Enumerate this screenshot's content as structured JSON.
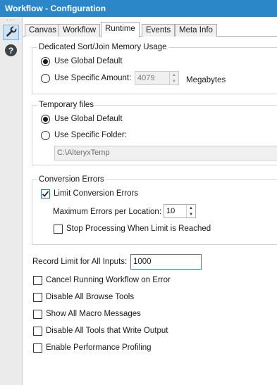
{
  "window": {
    "title": "Workflow - Configuration"
  },
  "sidebar": {
    "tool_icon": "wrench-icon",
    "help_icon": "question-icon",
    "help_glyph": "?",
    "dots": "···"
  },
  "tabs": [
    {
      "label": "Canvas",
      "active": false
    },
    {
      "label": "Workflow",
      "active": false
    },
    {
      "label": "Runtime",
      "active": true
    },
    {
      "label": "Events",
      "active": false
    },
    {
      "label": "Meta Info",
      "active": false
    }
  ],
  "memory": {
    "title": "Dedicated Sort/Join Memory Usage",
    "use_global_label": "Use Global Default",
    "use_global_checked": true,
    "use_specific_label": "Use Specific Amount:",
    "use_specific_checked": false,
    "amount_value": "4079",
    "unit_label": "Megabytes"
  },
  "temp_files": {
    "title": "Temporary files",
    "use_global_label": "Use Global Default",
    "use_global_checked": true,
    "use_specific_label": "Use Specific Folder:",
    "use_specific_checked": false,
    "folder_value": "C:\\AlteryxTemp"
  },
  "conversion": {
    "title": "Conversion Errors",
    "limit_label": "Limit Conversion Errors",
    "limit_checked": true,
    "max_label": "Maximum Errors per Location:",
    "max_value": "10",
    "stop_label": "Stop Processing When Limit is Reached",
    "stop_checked": false
  },
  "record_limit": {
    "label": "Record Limit for All Inputs:",
    "value": "1000"
  },
  "options": [
    {
      "label": "Cancel Running Workflow on Error",
      "checked": false
    },
    {
      "label": "Disable All Browse Tools",
      "checked": false
    },
    {
      "label": "Show All Macro Messages",
      "checked": false
    },
    {
      "label": "Disable All Tools that Write Output",
      "checked": false
    },
    {
      "label": "Enable Performance Profiling",
      "checked": false
    }
  ],
  "colors": {
    "titlebar": "#2b87c8",
    "accent": "#2b6cb0"
  }
}
